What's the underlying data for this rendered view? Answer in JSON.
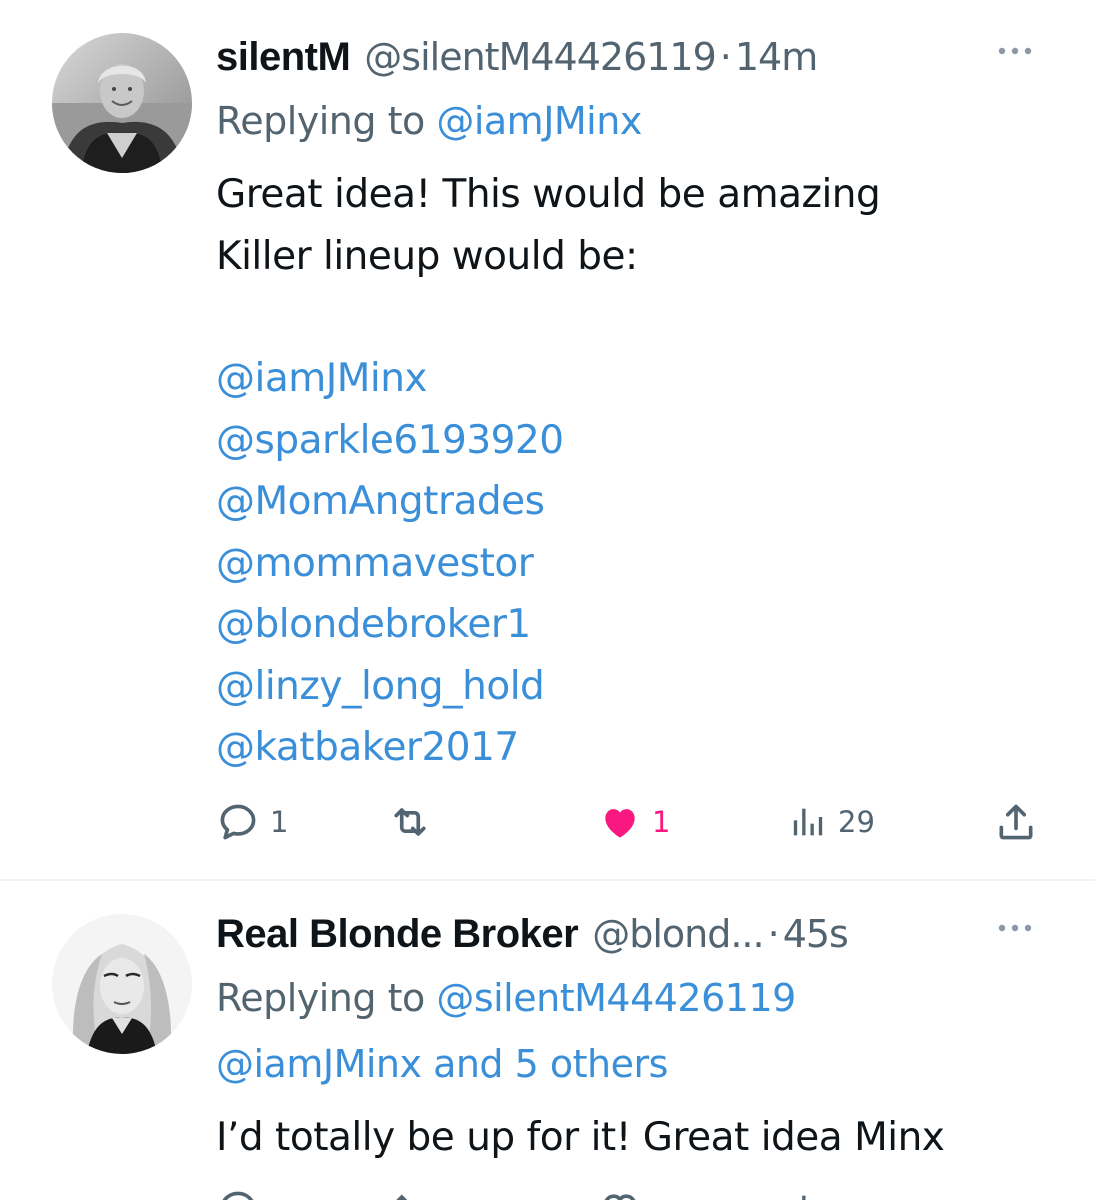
{
  "tweets": [
    {
      "display_name": "silentM",
      "handle": "@silentM44426119",
      "separator": "·",
      "time": "14m",
      "replying_prefix": "Replying to",
      "replying_to": "@iamJMinx",
      "body_lines": [
        "Great idea!  This would be amazing",
        "Killer lineup would be:"
      ],
      "mentions": [
        "@iamJMinx",
        "@sparkle6193920",
        "@MomAngtrades",
        "@mommavestor",
        "@blondebroker1",
        "@linzy_long_hold",
        "@katbaker2017"
      ],
      "actions": {
        "reply_count": "1",
        "retweet_count": "",
        "like_count": "1",
        "views_count": "29"
      }
    },
    {
      "display_name": "Real Blonde Broker",
      "handle": "@blond...",
      "separator": "·",
      "time": "45s",
      "replying_prefix": "Replying to",
      "replying_to": "@silentM44426119",
      "replying_to_more": "@iamJMinx and 5 others",
      "body_lines": [
        "I’d totally be up for it! Great idea Minx"
      ]
    }
  ],
  "colors": {
    "link": "#3a8fd8",
    "secondary_text": "#536471",
    "like_active": "#f91880",
    "divider": "#eff3f4"
  },
  "icons": {
    "reply": "reply-icon",
    "retweet": "retweet-icon",
    "like": "heart-filled-icon",
    "views": "views-icon",
    "share": "share-icon",
    "more": "more-icon"
  }
}
